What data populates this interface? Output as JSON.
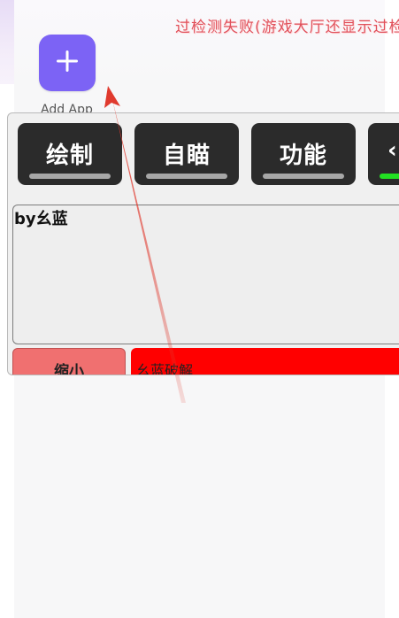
{
  "notice_text": "过检测失败(游戏大厅还显示过检",
  "add_app": {
    "icon": "plus-icon",
    "label": "Add App"
  },
  "tabs": [
    {
      "label": "绘制",
      "active": false
    },
    {
      "label": "自瞄",
      "active": false
    },
    {
      "label": "功能",
      "active": false
    },
    {
      "label": "‹",
      "active": true
    }
  ],
  "textbox": {
    "text": "by幺蓝"
  },
  "shrink_button": {
    "label": "缩小"
  },
  "crack_bar": {
    "label": "幺蓝破解"
  },
  "colors": {
    "accent_purple": "#7c63f5",
    "tab_bg": "#2b2b2b",
    "tab_active_bar": "#22e022",
    "shrink_red": "#f07070",
    "crack_red": "#ff0000",
    "notice_red": "#e0505a",
    "annotation_arrow": "#e03a2e"
  }
}
